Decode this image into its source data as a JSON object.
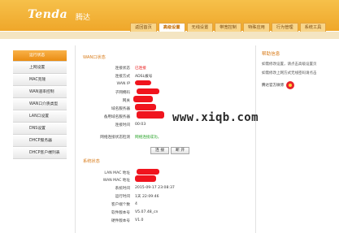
{
  "brand": {
    "logo": "Tenda",
    "logo_cn": "腾达"
  },
  "nav": {
    "tabs": [
      {
        "label": "返回首页",
        "active": false
      },
      {
        "label": "高级设置",
        "active": true
      },
      {
        "label": "无线设置",
        "active": false
      },
      {
        "label": "带宽控制",
        "active": false
      },
      {
        "label": "特殊应用",
        "active": false
      },
      {
        "label": "行为管理",
        "active": false
      },
      {
        "label": "系统工具",
        "active": false
      }
    ]
  },
  "sidebar": {
    "items": [
      {
        "label": "运行状态",
        "active": true
      },
      {
        "label": "上网设置",
        "active": false
      },
      {
        "label": "MAC克隆",
        "active": false
      },
      {
        "label": "WAN速率控制",
        "active": false
      },
      {
        "label": "WAN口介质类型",
        "active": false
      },
      {
        "label": "LAN口设置",
        "active": false
      },
      {
        "label": "DNS设置",
        "active": false
      },
      {
        "label": "DHCP服务器",
        "active": false
      },
      {
        "label": "DHCP客户端列表",
        "active": false
      }
    ]
  },
  "wan_status": {
    "title": "WAN口状态",
    "rows": [
      {
        "label": "连接状态",
        "value": "已连接"
      },
      {
        "label": "连接方式",
        "value": "ADSL拨号"
      },
      {
        "label": "WAN IP",
        "value": ""
      },
      {
        "label": "子网掩码",
        "value": ""
      },
      {
        "label": "网关",
        "value": ""
      },
      {
        "label": "域名服务器",
        "value": ""
      },
      {
        "label": "备用域名服务器",
        "value": ""
      },
      {
        "label": "连接时间",
        "value": "00:03"
      }
    ],
    "check_label": "网络连接状态检测",
    "check_value": "网络连接成功。",
    "buttons": {
      "connect": "连 接",
      "disconnect": "断 开"
    }
  },
  "system_status": {
    "title": "系统状态",
    "rows": [
      {
        "label": "LAN MAC 地址",
        "value": ""
      },
      {
        "label": "WAN MAC 地址",
        "value": ""
      },
      {
        "label": "系统时间",
        "value": "2015-09-17 23:08:37"
      },
      {
        "label": "运行时间",
        "value": "1天 22:09:46"
      },
      {
        "label": "客户端个数",
        "value": "4"
      },
      {
        "label": "软件版本号",
        "value": "V5.07.48_cn"
      },
      {
        "label": "硬件版本号",
        "value": "V1.0"
      }
    ]
  },
  "help": {
    "title": "帮助信息",
    "paragraphs": [
      "如需修改设置，请点击高级设置页",
      "如需修改上网方式无线密码请点击"
    ],
    "weibo_label": "腾达官方微博"
  },
  "watermark": "www.xiqb.com",
  "colors": {
    "accent": "#efa72a",
    "status_connected": "#e81515",
    "status_ok": "#29a329",
    "redaction": "#f0141e"
  }
}
